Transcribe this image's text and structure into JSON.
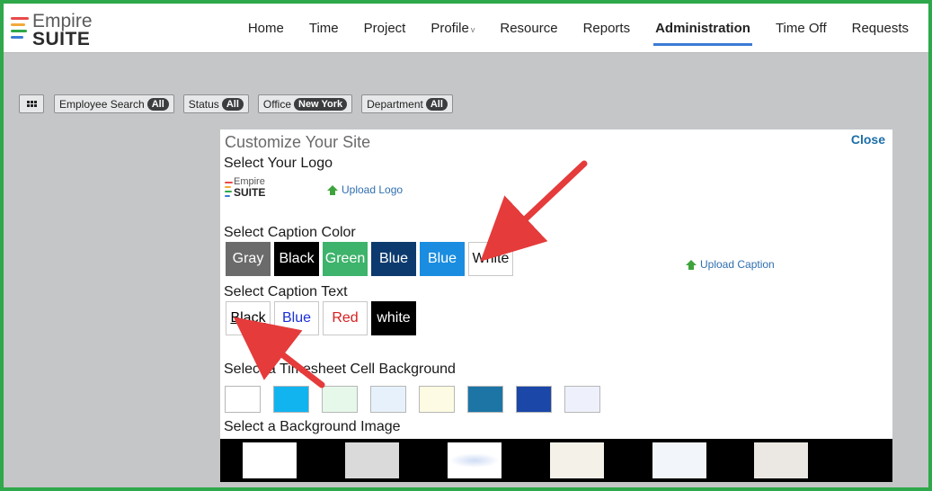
{
  "app": {
    "logo_line1": "Empire",
    "logo_line2": "SUITE",
    "logo_colors": [
      "#e94a4a",
      "#f2a93b",
      "#2ea84a",
      "#3a7bd5"
    ]
  },
  "nav": {
    "items": [
      {
        "label": "Home"
      },
      {
        "label": "Time"
      },
      {
        "label": "Project"
      },
      {
        "label": "Profile"
      },
      {
        "label": "Resource"
      },
      {
        "label": "Reports"
      },
      {
        "label": "Administration"
      },
      {
        "label": "Time Off"
      },
      {
        "label": "Requests"
      }
    ],
    "active": "Administration",
    "profile_caret": "v"
  },
  "filters": [
    {
      "label": "Employee Search",
      "value": "All"
    },
    {
      "label": "Status",
      "value": "All"
    },
    {
      "label": "Office",
      "value": "New York"
    },
    {
      "label": "Department",
      "value": "All"
    }
  ],
  "panel": {
    "title": "Customize Your Site",
    "close_label": "Close",
    "logo_section": "Select Your Logo",
    "upload_logo": "Upload Logo",
    "caption_color_section": "Select Caption Color",
    "upload_caption": "Upload Caption",
    "caption_colors": [
      {
        "label": "Gray",
        "bg": "#6b6b6b",
        "fg": "#ffffff"
      },
      {
        "label": "Black",
        "bg": "#000000",
        "fg": "#ffffff"
      },
      {
        "label": "Green",
        "bg": "#3db36b",
        "fg": "#ffffff"
      },
      {
        "label": "Blue",
        "bg": "#0d3a6e",
        "fg": "#ffffff"
      },
      {
        "label": "Blue",
        "bg": "#1a8de0",
        "fg": "#ffffff"
      },
      {
        "label": "White",
        "bg": "#ffffff",
        "fg": "#111111"
      }
    ],
    "caption_text_section": "Select Caption Text",
    "caption_texts": [
      {
        "label": "Black",
        "color": "#000000",
        "bg": "#ffffff"
      },
      {
        "label": "Blue",
        "color": "#1a2fd6",
        "bg": "#ffffff"
      },
      {
        "label": "Red",
        "color": "#d81e1e",
        "bg": "#ffffff"
      },
      {
        "label": "white",
        "color": "#ffffff",
        "bg": "#000000"
      }
    ],
    "cell_bg_section": "Select a Timesheet Cell Background",
    "cell_backgrounds": [
      "#ffffff",
      "#11b4ef",
      "#e6f8ea",
      "#e6f1fb",
      "#fdfbe3",
      "#1d75a6",
      "#1a47a8",
      "#eef0fb"
    ],
    "bg_image_section": "Select a Background Image",
    "bg_images": [
      "#ffffff",
      "#dadada",
      "#cfdcf5",
      "#f4f1e9",
      "#f2f6fa",
      "#ebe8e3"
    ]
  },
  "annotation": {
    "arrow_color": "#e53b3b"
  }
}
